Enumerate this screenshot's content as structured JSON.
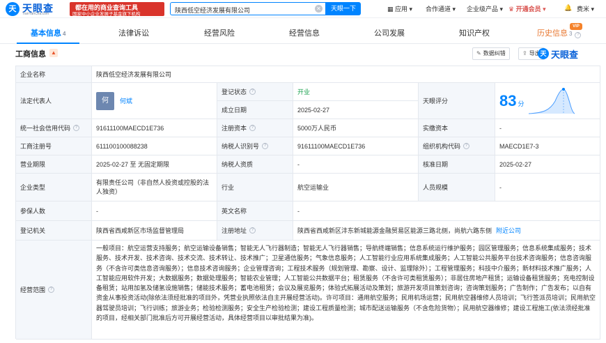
{
  "header": {
    "logo_mark": "天",
    "logo_name": "天眼查",
    "logo_domain": "TianYanCha.com",
    "slogan_line1": "都在用的商业查询工具",
    "slogan_line2": "国家中小企业发展子基金旗下机构",
    "search_value": "陕西低空经济发展有限公司",
    "search_button": "天眼一下",
    "nav": [
      "应用",
      "合作通道",
      "企业级产品",
      "开通会员",
      "费米"
    ]
  },
  "tabs": [
    {
      "label": "基本信息",
      "count": "4"
    },
    {
      "label": "法律诉讼",
      "count": ""
    },
    {
      "label": "经营风险",
      "count": ""
    },
    {
      "label": "经营信息",
      "count": ""
    },
    {
      "label": "公司发展",
      "count": ""
    },
    {
      "label": "知识产权",
      "count": ""
    },
    {
      "label": "历史信息",
      "count": "3"
    }
  ],
  "vip_badge": "VIP",
  "section": {
    "title": "工商信息",
    "correction_button": "数据纠错",
    "export_button": "导出",
    "brand": "天眼查"
  },
  "rows": {
    "company_name_label": "企业名称",
    "company_name": "陕西低空经济发展有限公司",
    "legal_rep_label": "法定代表人",
    "legal_rep_avatar": "何",
    "legal_rep": "何斌",
    "reg_status_label": "登记状态",
    "reg_status": "开业",
    "est_date_label": "成立日期",
    "est_date": "2025-02-27",
    "score_label": "天眼评分",
    "score": "83",
    "score_unit": "分",
    "credit_code_label": "统一社会信用代码",
    "credit_code": "91611100MAECD1E736",
    "reg_capital_label": "注册资本",
    "reg_capital": "5000万人民币",
    "paid_capital_label": "实缴资本",
    "paid_capital": "-",
    "reg_no_label": "工商注册号",
    "reg_no": "611100100088238",
    "taxpayer_id_label": "纳税人识别号",
    "taxpayer_id": "91611100MAECD1E736",
    "org_code_label": "组织机构代码",
    "org_code": "MAECD1E7-3",
    "biz_term_label": "营业期限",
    "biz_term": "2025-02-27 至 无固定期限",
    "taxpayer_qual_label": "纳税人资质",
    "taxpayer_qual": "-",
    "approval_date_label": "核准日期",
    "approval_date": "2025-02-27",
    "company_type_label": "企业类型",
    "company_type": "有限责任公司（非自然人投资或控股的法人独资）",
    "industry_label": "行业",
    "industry": "航空运输业",
    "staff_size_label": "人员规模",
    "staff_size": "-",
    "insured_label": "参保人数",
    "insured": "-",
    "english_name_label": "英文名称",
    "english_name": "-",
    "reg_authority_label": "登记机关",
    "reg_authority": "陕西省西咸新区市场监督管理局",
    "reg_address_label": "注册地址",
    "reg_address": "陕西省西咸新区沣东新城能源金融贸易区能源三路北侧，尚航六路东侧",
    "nearby_link": "附近公司",
    "scope_label": "经营范围",
    "scope": "一般项目：航空运营支持服务；航空运输设备销售；智能无人飞行器制造；智能无人飞行器销售；导航终端销售；信息系统运行维护服务；园区管理服务；信息系统集成服务；技术服务、技术开发、技术咨询、技术交流、技术转让、技术推广；卫星通信服务；气象信息服务；人工智能行业应用系统集成服务；人工智能公共服务平台技术咨询服务；信息咨询服务（不含许可类信息咨询服务）；信息技术咨询服务；企业管理咨询；工程技术服务（规划管理、勘察、设计、监理除外）；工程管理服务；科技中介服务；新材料技术推广服务；人工智能应用软件开发；大数据服务；数据处理服务；智能农业管理；人工智能公共数据平台；租赁服务（不含许可类租赁服务）；非居住房地产租赁；运输设备租赁服务；充电控制设备租赁；站用加氢及储氢设施销售；储能技术服务；蓄电池租赁；会议及展览服务；体验式拓展活动及策划；旅游开发项目策划咨询；咨询策划服务；广告制作；广告发布；以自有资金从事投资活动(除依法须经批准的项目外，凭营业执照依法自主开展经营活动)。许可项目：通用航空服务；民用机场运营；民用航空器维修人员培训；飞行签派员培训；民用航空器驾驶员培训；飞行训练；旅游业务；检验检测服务；安全生产检验检测；建设工程质量检测；城市配送运输服务（不含危险货物）；民用航空器维修；建设工程施工(依法须经批准的项目，经相关部门批准后方可开展经营活动，具体经营项目以审批结果为准)。"
  },
  "colors": {
    "brand_blue": "#0084ff",
    "label_bg": "#f4f7fb",
    "status_green": "#1aa14f",
    "vip_red": "#d9534f",
    "history_orange": "#e87832"
  },
  "icons": [
    "search-clear-icon",
    "grid-app-icon",
    "dropdown-arrow-icon",
    "vip-crown-icon",
    "bell-icon",
    "user-avatar-icon",
    "question-icon",
    "edit-icon",
    "export-icon",
    "fire-icon"
  ]
}
